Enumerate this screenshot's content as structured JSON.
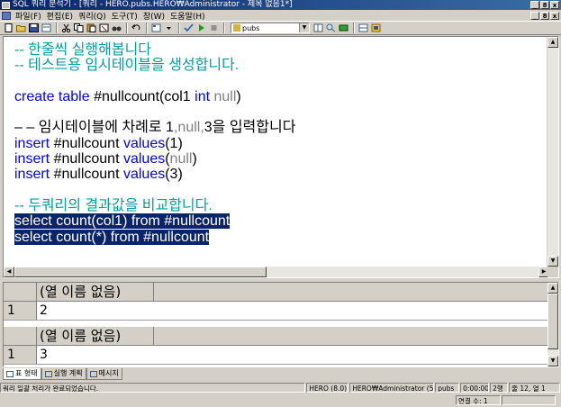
{
  "window": {
    "title": "SQL 쿼리 분석기 - [쿼리 - HERO.pubs.HERO₩Administrator - 제목 없음1*]",
    "minimize": "_",
    "restore": "8",
    "close": "x"
  },
  "menu": {
    "items": [
      "파일(F)",
      "편집(E)",
      "쿼리(Q)",
      "도구(T)",
      "창(W)",
      "도움말(H)"
    ]
  },
  "toolbar": {
    "database": "pubs"
  },
  "editor": {
    "lines": [
      [
        {
          "t": "-- 한줄씩 실행해봅니다",
          "c": "cmt"
        }
      ],
      [
        {
          "t": "-- 테스트용 임시테이블을 생성합니다.",
          "c": "cmt"
        }
      ],
      [
        {
          "t": "",
          "c": "tx"
        }
      ],
      [
        {
          "t": "create table ",
          "c": "kw"
        },
        {
          "t": "#nullcount(col1 ",
          "c": "tx"
        },
        {
          "t": "int ",
          "c": "kw"
        },
        {
          "t": "null",
          "c": "gr"
        },
        {
          "t": ")",
          "c": "tx"
        }
      ],
      [
        {
          "t": "",
          "c": "tx"
        }
      ],
      [
        {
          "t": "– – 임시테이블에 차례로 1",
          "c": "tx"
        },
        {
          "t": ",null,",
          "c": "gr"
        },
        {
          "t": "3을 입력합니다",
          "c": "tx"
        }
      ],
      [
        {
          "t": "insert ",
          "c": "kw"
        },
        {
          "t": "#nullcount ",
          "c": "tx"
        },
        {
          "t": "values",
          "c": "kw"
        },
        {
          "t": "(1)",
          "c": "tx"
        }
      ],
      [
        {
          "t": "insert ",
          "c": "kw"
        },
        {
          "t": "#nullcount ",
          "c": "tx"
        },
        {
          "t": "values",
          "c": "kw"
        },
        {
          "t": "(",
          "c": "tx"
        },
        {
          "t": "null",
          "c": "gr"
        },
        {
          "t": ")",
          "c": "tx"
        }
      ],
      [
        {
          "t": "insert ",
          "c": "kw"
        },
        {
          "t": "#nullcount ",
          "c": "tx"
        },
        {
          "t": "values",
          "c": "kw"
        },
        {
          "t": "(3)",
          "c": "tx"
        }
      ],
      [
        {
          "t": "",
          "c": "tx"
        }
      ],
      [
        {
          "t": "-- 두쿼리의 결과값을 비교합니다.",
          "c": "cmt"
        }
      ],
      [
        {
          "t": "select count(col1) from #nullcount",
          "c": "sel"
        }
      ],
      [
        {
          "t": "select count(*) from #nullcount",
          "c": "sel"
        }
      ]
    ]
  },
  "results": {
    "grids": [
      {
        "header": "(열 이름 없음)",
        "row_number": "1",
        "value": "2"
      },
      {
        "header": "(열 이름 없음)",
        "row_number": "1",
        "value": "3"
      }
    ]
  },
  "tabs": [
    "표 형태",
    "실행 계획",
    "메시지"
  ],
  "status": {
    "message": "쿼리 일괄 처리가 완료되었습니다.",
    "server": "HERO (8.0)",
    "user": "HERO₩Administrator (51)",
    "database": "pubs",
    "elapsed": "0:00:00",
    "rows": "2행",
    "position": "줄 12, 열 1",
    "connections": "연결 수: 1"
  }
}
